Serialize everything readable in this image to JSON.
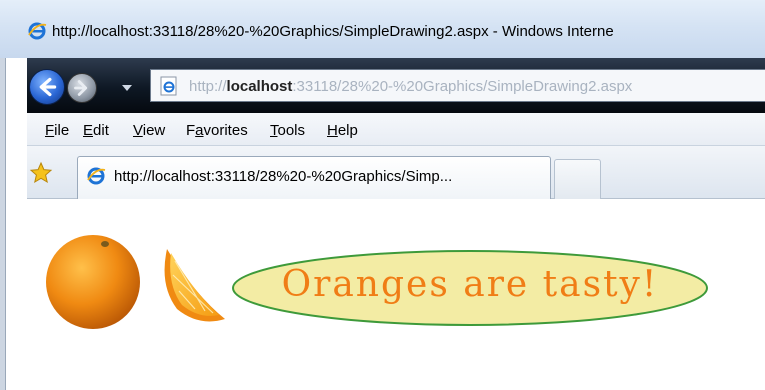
{
  "window": {
    "title": "http://localhost:33118/28%20-%20Graphics/SimpleDrawing2.aspx - Windows Interne"
  },
  "address_bar": {
    "scheme": "http://",
    "host": "localhost",
    "rest": ":33118/28%20-%20Graphics/SimpleDrawing2.aspx"
  },
  "menu": {
    "items": [
      {
        "access_key": "F",
        "rest": "ile"
      },
      {
        "access_key": "E",
        "rest": "dit"
      },
      {
        "access_key": "V",
        "rest": "iew"
      },
      {
        "prefix": "F",
        "access_key": "a",
        "rest": "vorites"
      },
      {
        "access_key": "T",
        "rest": "ools"
      },
      {
        "access_key": "H",
        "rest": "elp"
      }
    ]
  },
  "tabs": {
    "active_label": "http://localhost:33118/28%20-%20Graphics/Simp..."
  },
  "page": {
    "banner_text": "Oranges are tasty!",
    "banner_fill": "#f3eca4",
    "banner_stroke": "#3e9a3a",
    "banner_text_color": "#f07d16",
    "images": [
      "orange-whole",
      "orange-wedge"
    ]
  },
  "icons": {
    "title": "ie-logo-icon",
    "address": "ie-page-icon",
    "tab": "ie-logo-icon",
    "favorites": "favorites-star-icon",
    "back": "back-arrow-icon",
    "forward": "forward-arrow-icon",
    "dropdown": "chevron-down-icon"
  }
}
